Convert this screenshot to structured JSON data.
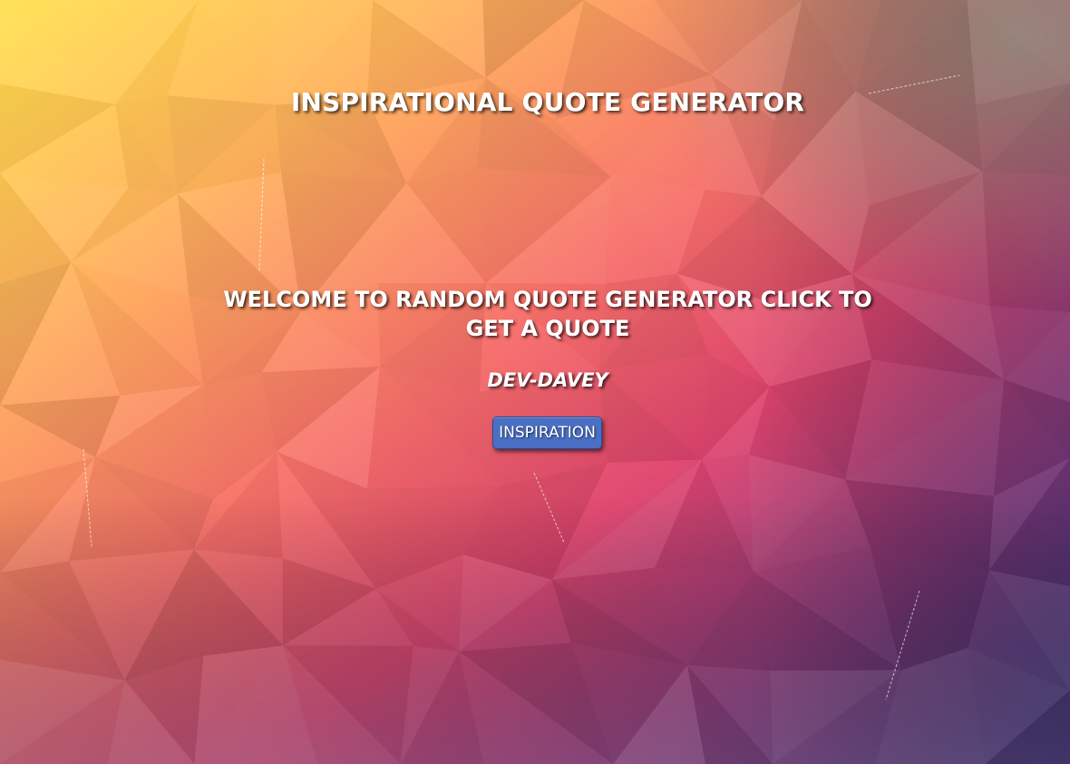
{
  "page": {
    "title": "INSPIRATIONAL QUOTE GENERATOR"
  },
  "quote": {
    "text": "WELCOME TO RANDOM QUOTE GENERATOR CLICK TO GET A QUOTE",
    "author": "DEV-DAVEY"
  },
  "actions": {
    "inspiration_label": "INSPIRATION"
  },
  "colors": {
    "button": "#4a6fc4",
    "text": "#ffffff",
    "gradient_warm": "#ffd84a",
    "gradient_mid": "#f2557a",
    "gradient_cool": "#2a2a78"
  }
}
